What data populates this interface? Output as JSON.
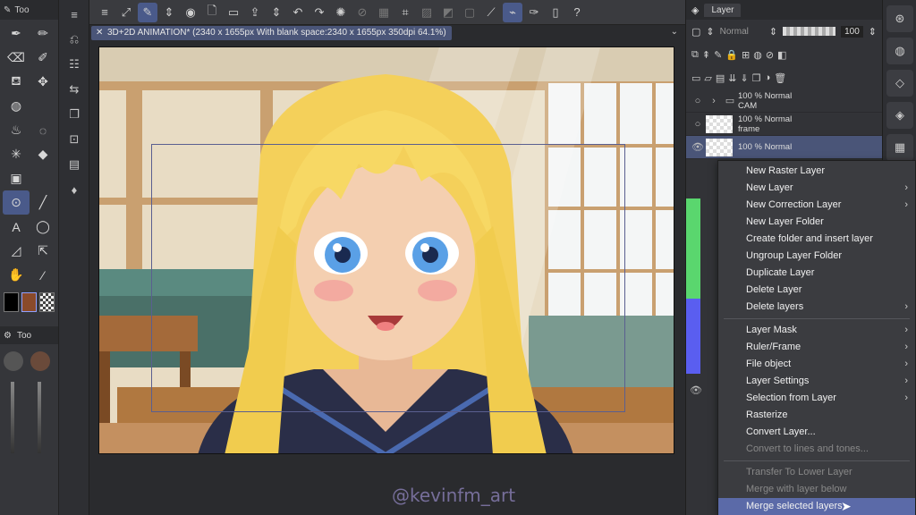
{
  "canvas_tab": {
    "title": "3D+2D ANIMATION* (2340 x 1655px With blank space:2340 x 1655px 350dpi 64.1%)"
  },
  "left_panel": {
    "header_label": "Too",
    "sub_header_label": "Too"
  },
  "layer_panel": {
    "tab_label": "Layer",
    "blend_mode": "Normal",
    "opacity": "100",
    "layers": [
      {
        "opacity": "100 %",
        "mode": "Normal",
        "name": "CAM"
      },
      {
        "opacity": "100 %",
        "mode": "Normal",
        "name": "frame"
      },
      {
        "opacity": "100 %",
        "mode": "Normal",
        "name": ""
      }
    ]
  },
  "context_menu": {
    "items": [
      {
        "label": "New Raster Layer",
        "submenu": false,
        "disabled": false
      },
      {
        "label": "New Layer",
        "submenu": true,
        "disabled": false
      },
      {
        "label": "New Correction Layer",
        "submenu": true,
        "disabled": false
      },
      {
        "label": "New Layer Folder",
        "submenu": false,
        "disabled": false
      },
      {
        "label": "Create folder and insert layer",
        "submenu": false,
        "disabled": false
      },
      {
        "label": "Ungroup Layer Folder",
        "submenu": false,
        "disabled": false
      },
      {
        "label": "Duplicate Layer",
        "submenu": false,
        "disabled": false
      },
      {
        "label": "Delete Layer",
        "submenu": false,
        "disabled": false
      },
      {
        "label": "Delete layers",
        "submenu": true,
        "disabled": false
      },
      {
        "label": "Layer Mask",
        "submenu": true,
        "disabled": false
      },
      {
        "label": "Ruler/Frame",
        "submenu": true,
        "disabled": false
      },
      {
        "label": "File object",
        "submenu": true,
        "disabled": false
      },
      {
        "label": "Layer Settings",
        "submenu": true,
        "disabled": false
      },
      {
        "label": "Selection from Layer",
        "submenu": true,
        "disabled": false
      },
      {
        "label": "Rasterize",
        "submenu": false,
        "disabled": false
      },
      {
        "label": "Convert Layer...",
        "submenu": false,
        "disabled": false
      },
      {
        "label": "Convert to lines and tones...",
        "submenu": false,
        "disabled": true
      },
      {
        "label": "Transfer To Lower Layer",
        "submenu": false,
        "disabled": true
      },
      {
        "label": "Merge with layer below",
        "submenu": false,
        "disabled": true
      },
      {
        "label": "Merge selected layers",
        "submenu": false,
        "disabled": false,
        "selected": true
      }
    ]
  },
  "watermark": "@kevinfm_art",
  "colors": {
    "accent": "#5b6aa8",
    "main_color": "#8a4a2a",
    "layer_green": "#5ad66e",
    "layer_blue": "#5a5ef0"
  }
}
